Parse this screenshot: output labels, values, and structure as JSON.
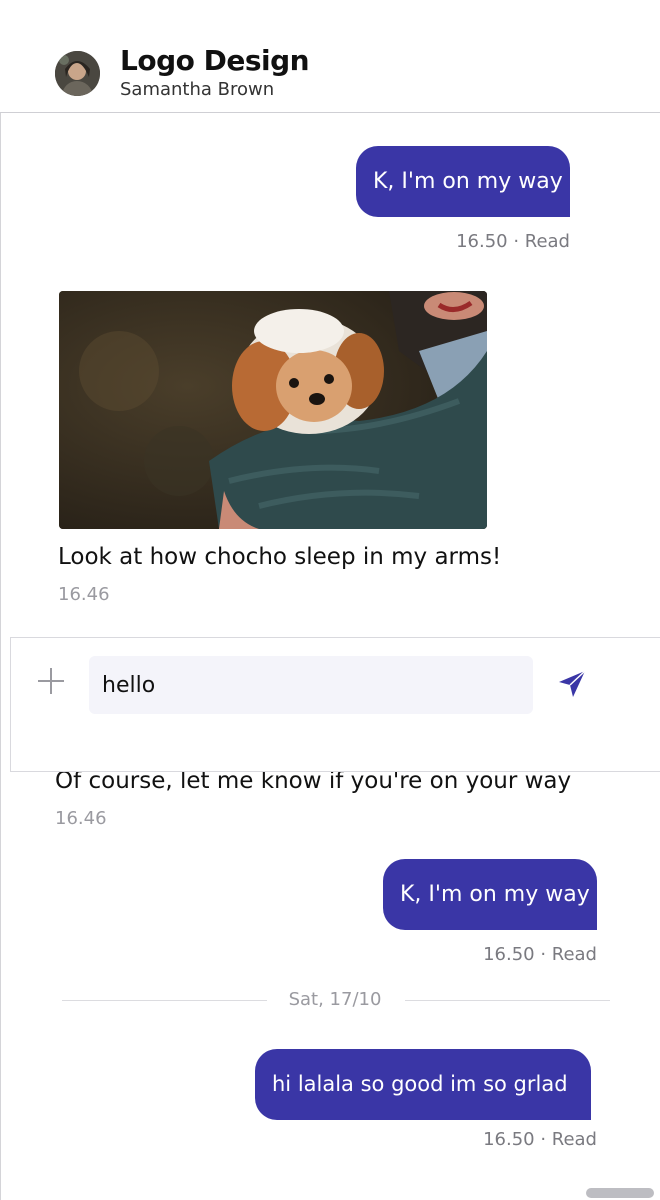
{
  "header": {
    "title": "Logo Design",
    "subtitle": "Samantha Brown"
  },
  "messages": [
    {
      "type": "sent",
      "text": "K, I'm on my way",
      "meta": "16.50 · Read"
    },
    {
      "type": "received_image",
      "caption": "Look at how chocho sleep in my arms!",
      "meta": "16.46"
    },
    {
      "type": "received",
      "text": "Of course, let me know if you're on your way",
      "meta": "16.46"
    },
    {
      "type": "sent",
      "text": "K, I'm on my way",
      "meta": "16.50 · Read"
    },
    {
      "type": "sent",
      "text": "hi lalala so good im so grlad",
      "meta": "16.50 · Read"
    }
  ],
  "date_divider": "Sat, 17/10",
  "composer": {
    "value": "hello",
    "add_icon": "plus-icon",
    "send_icon": "send-icon"
  },
  "colors": {
    "sent_bubble": "#3a36a6",
    "send_icon": "#3a36a6",
    "meta_text": "#7a7a80"
  }
}
